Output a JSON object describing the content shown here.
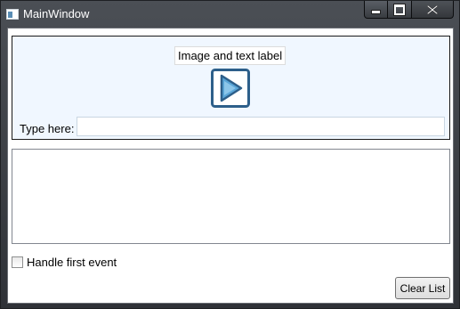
{
  "window": {
    "title": "MainWindow",
    "controls": [
      "minimize-icon",
      "maximize-icon",
      "close-icon"
    ]
  },
  "panel": {
    "label_text": "Image and text label",
    "image_icon": "play-icon",
    "type_label": "Type here:",
    "input_value": ""
  },
  "list": {
    "items": []
  },
  "checkbox": {
    "label": "Handle first event",
    "checked": false
  },
  "buttons": {
    "clear_list": "Clear List"
  },
  "colors": {
    "panel_background": "#f0f7ff",
    "play_icon_fill": "#5aa6d8",
    "play_icon_border": "#2d5f8a"
  }
}
